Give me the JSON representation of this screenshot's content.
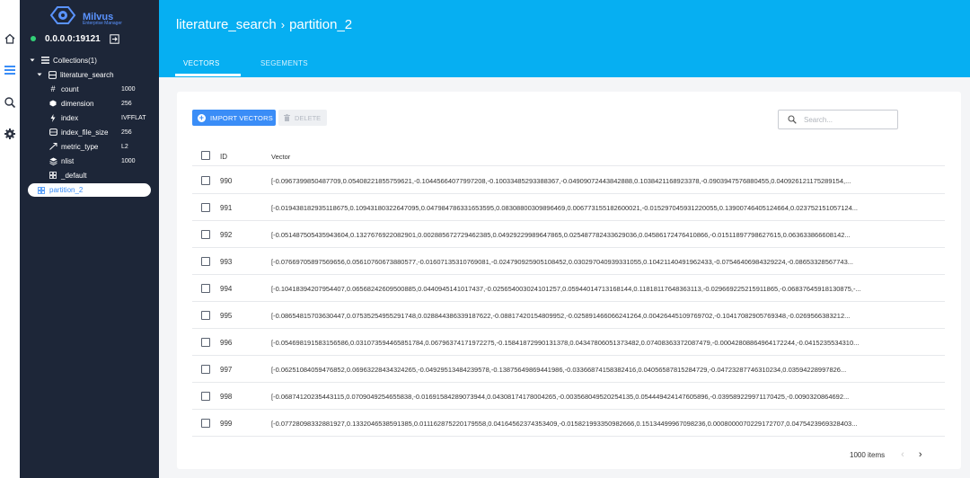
{
  "app": {
    "name": "Milvus",
    "subtitle": "Enterprise Manager"
  },
  "rail": {
    "icons": [
      "home-icon",
      "overview-icon",
      "search-icon",
      "settings-icon"
    ]
  },
  "connection": {
    "address": "0.0.0.0:19121",
    "status_color": "#32d077"
  },
  "tree": {
    "collections_label": "Collections(1)",
    "collection_name": "literature_search",
    "props": [
      {
        "label": "count",
        "value": "1000"
      },
      {
        "label": "dimension",
        "value": "256"
      },
      {
        "label": "index",
        "value": "IVFFLAT"
      },
      {
        "label": "index_file_size",
        "value": "256"
      },
      {
        "label": "metric_type",
        "value": "L2"
      },
      {
        "label": "nlist",
        "value": "1000"
      }
    ],
    "partitions": [
      {
        "label": "_default"
      },
      {
        "label": "partition_2",
        "selected": true
      }
    ]
  },
  "header": {
    "collection": "literature_search",
    "separator": "›",
    "partition": "partition_2",
    "accent": "#06aff2"
  },
  "tabs": [
    {
      "label": "VECTORS",
      "active": true
    },
    {
      "label": "SEGEMENTS",
      "active": false
    }
  ],
  "toolbar": {
    "import_label": "IMPORT VECTORS",
    "delete_label": "DELETE",
    "search_placeholder": "Search..."
  },
  "table": {
    "columns": [
      "ID",
      "Vector"
    ],
    "rows": [
      {
        "id": "990",
        "vector": "[-0.0967399850487709,0.05408221855759621,-0.10445664077997208,-0.10033485293388367,-0.04909072443842888,0.1038421168923378,-0.0903947576880455,0.040926121175289154,..."
      },
      {
        "id": "991",
        "vector": "[-0.019438182935118675,0.10943180322647095,0.047984786331653595,0.08308800309896469,0.006773155182600021,-0.015297045931220055,0.13900746405124664,0.023752151057124..."
      },
      {
        "id": "992",
        "vector": "[-0.051487505435943604,0.1327676922082901,0.002885672729462385,0.04929229989647865,0.025487782433629036,0.04586172476410866,-0.01511897798627615,0.063633866608142..."
      },
      {
        "id": "993",
        "vector": "[-0.07669705897569656,0.05610760673880577,-0.01607135310769081,-0.024790925905108452,0.030297040939331055,0.10421140491962433,-0.07546406984329224,-0.08653328567743..."
      },
      {
        "id": "994",
        "vector": "[-0.10418394207954407,0.06568242609500885,0.0440945141017437,-0.025654003024101257,0.05944014713168144,0.11818117648363113,-0.029669225215911865,-0.06837645918130875,-..."
      },
      {
        "id": "995",
        "vector": "[-0.08654815703630447,0.07535254955291748,0.028844386339187622,-0.08817420154809952,-0.025891466066241264,0.00426445109769702,-0.10417082905769348,-0.0269566383212..."
      },
      {
        "id": "996",
        "vector": "[-0.054698191583156586,0.031073594465851784,0.06796374171972275,-0.15841872990131378,0.04347806051373482,0.07408363372087479,-0.00042808864964172244,-0.0415235534310..."
      },
      {
        "id": "997",
        "vector": "[-0.06251084059476852,0.06963228434324265,-0.04929513484239578,-0.13875649869441986,-0.03366874158382416,0.04056587815284729,-0.04723287746310234,0.03594228997826..."
      },
      {
        "id": "998",
        "vector": "[-0.06874120235443115,0.0709049254655838,-0.01691584289073944,0.04308174178004265,-0.003568049520254135,0.054449424147605896,-0.039589229971170425,-0.0090320864692..."
      },
      {
        "id": "999",
        "vector": "[-0.07728098332881927,0.1332046538591385,0.011162875220179558,0.04164562374353409,-0.015821993350982666,0.15134499967098236,0.0008000070229172707,0.0475423969328403..."
      }
    ]
  },
  "pagination": {
    "total_label": "1000 items",
    "prev": "‹",
    "next": "›"
  },
  "colors": {
    "primary": "#3a8df7",
    "sidebar_bg": "#1d2638",
    "selected_partition": "#3a8df7"
  }
}
